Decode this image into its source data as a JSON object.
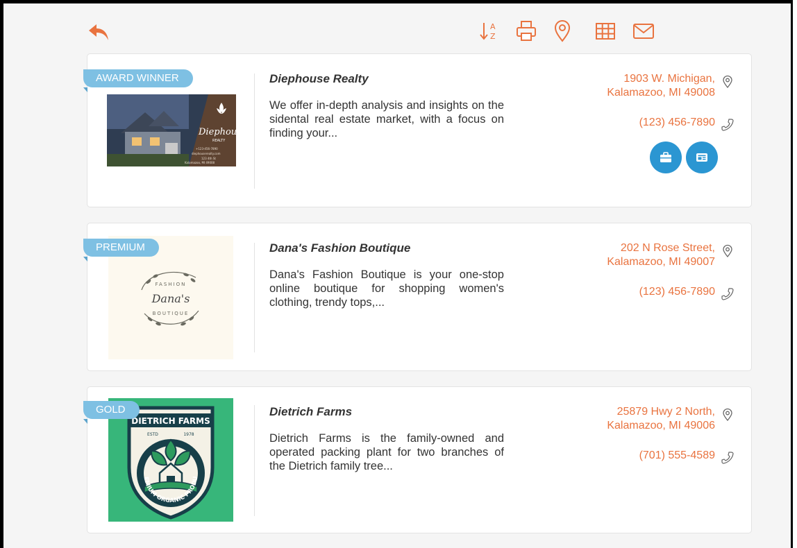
{
  "colors": {
    "accent": "#e9733f",
    "ribbon": "#7ec0e3",
    "button_blue": "#2b96d2"
  },
  "toolbar": {
    "back_icon": "undo-arrow-icon",
    "tools": [
      "sort-az-icon",
      "print-icon",
      "map-pin-icon",
      "grid-icon",
      "mail-icon"
    ]
  },
  "listings": [
    {
      "badge": "AWARD WINNER",
      "name": "Diephouse Realty",
      "description": "We offer in-depth analysis and insights on the sidental real estate market, with a focus on finding your...",
      "address_line1": "1903 W. Michigan,",
      "address_line2": "Kalamazoo, MI 49008",
      "phone": "(123) 456-7890",
      "logo": {
        "script": "Diephouse",
        "sub": "REALTY",
        "line1": "+123-456-7890",
        "line2": "diephouserealty.com",
        "line3": "123 4th St",
        "line4": "Kalamazoo, MI 49008"
      },
      "action_icons": [
        "briefcase-icon",
        "id-card-icon"
      ]
    },
    {
      "badge": "PREMIUM",
      "name": "Dana's Fashion Boutique",
      "description": "Dana's Fashion Boutique is your one-stop online boutique for shopping women's clothing, trendy tops,...",
      "address_line1": "202 N Rose Street,",
      "address_line2": "Kalamazoo, MI 49007",
      "phone": "(123) 456-7890",
      "logo": {
        "top": "FASHION",
        "script": "Dana's",
        "bottom": "BOUTIQUE"
      }
    },
    {
      "badge": "GOLD",
      "name": "Dietrich Farms",
      "description": "Dietrich Farms is the family-owned and operated packing plant for two branches of the Dietrich family tree...",
      "address_line1": "25879 Hwy 2 North,",
      "address_line2": "Kalamazoo, MI 49006",
      "phone": "(701) 555-4589",
      "logo": {
        "title": "DIETRICH FARMS",
        "estd": "ESTD",
        "year": "1978",
        "ring": "PREMIUM ORGANIC PRODUCT"
      }
    }
  ]
}
